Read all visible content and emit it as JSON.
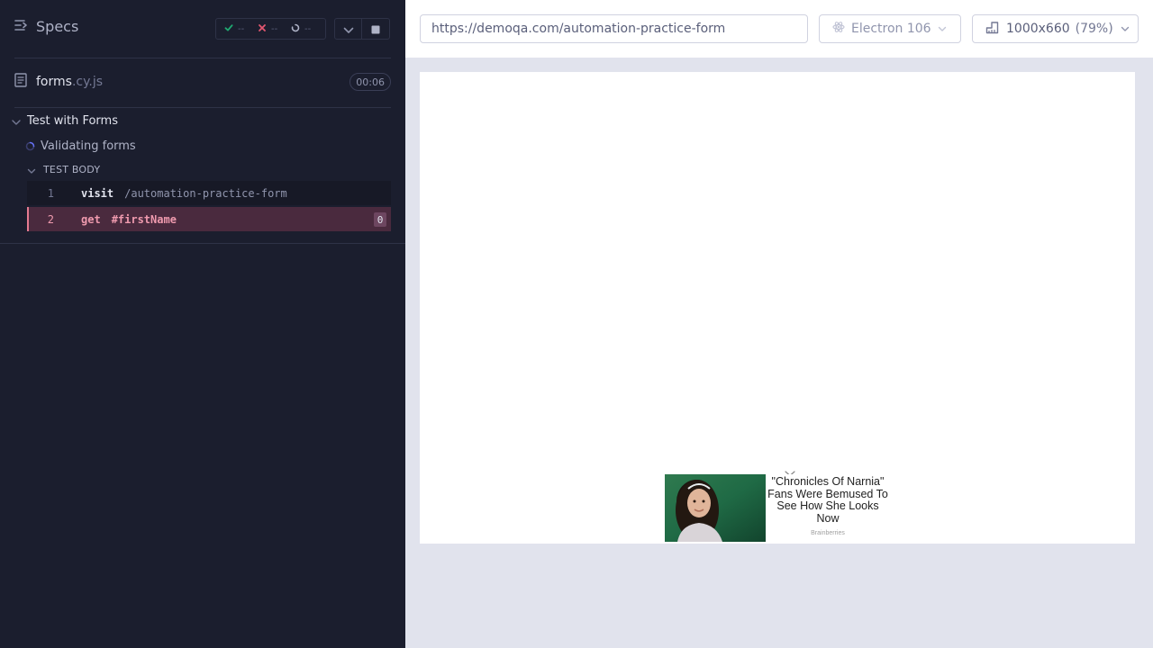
{
  "reporter": {
    "specs_label": "Specs",
    "stats": {
      "passed": "--",
      "failed": "--",
      "pending": "--"
    },
    "spec": {
      "name": "forms",
      "ext": ".cy.js",
      "duration": "00:06"
    },
    "suite_title": "Test with Forms",
    "test_title": "Validating forms",
    "body_label": "TEST BODY",
    "commands": [
      {
        "num": "1",
        "name": "visit",
        "message": "/automation-practice-form",
        "state": "passed"
      },
      {
        "num": "2",
        "name": "get",
        "message": "#firstName",
        "count": "0",
        "state": "failed"
      }
    ],
    "colors": {
      "passed": "#1fa971",
      "failed": "#e45770",
      "running": "#6470f3"
    }
  },
  "aut": {
    "url": "https://demoqa.com/automation-practice-form",
    "browser": "Electron 106",
    "viewport": "1000x660",
    "scale": "(79%)",
    "ad": {
      "headline": "\"Chronicles Of Narnia\" Fans Were Bemused To See How She Looks Now",
      "brand": "Brainberries"
    }
  }
}
